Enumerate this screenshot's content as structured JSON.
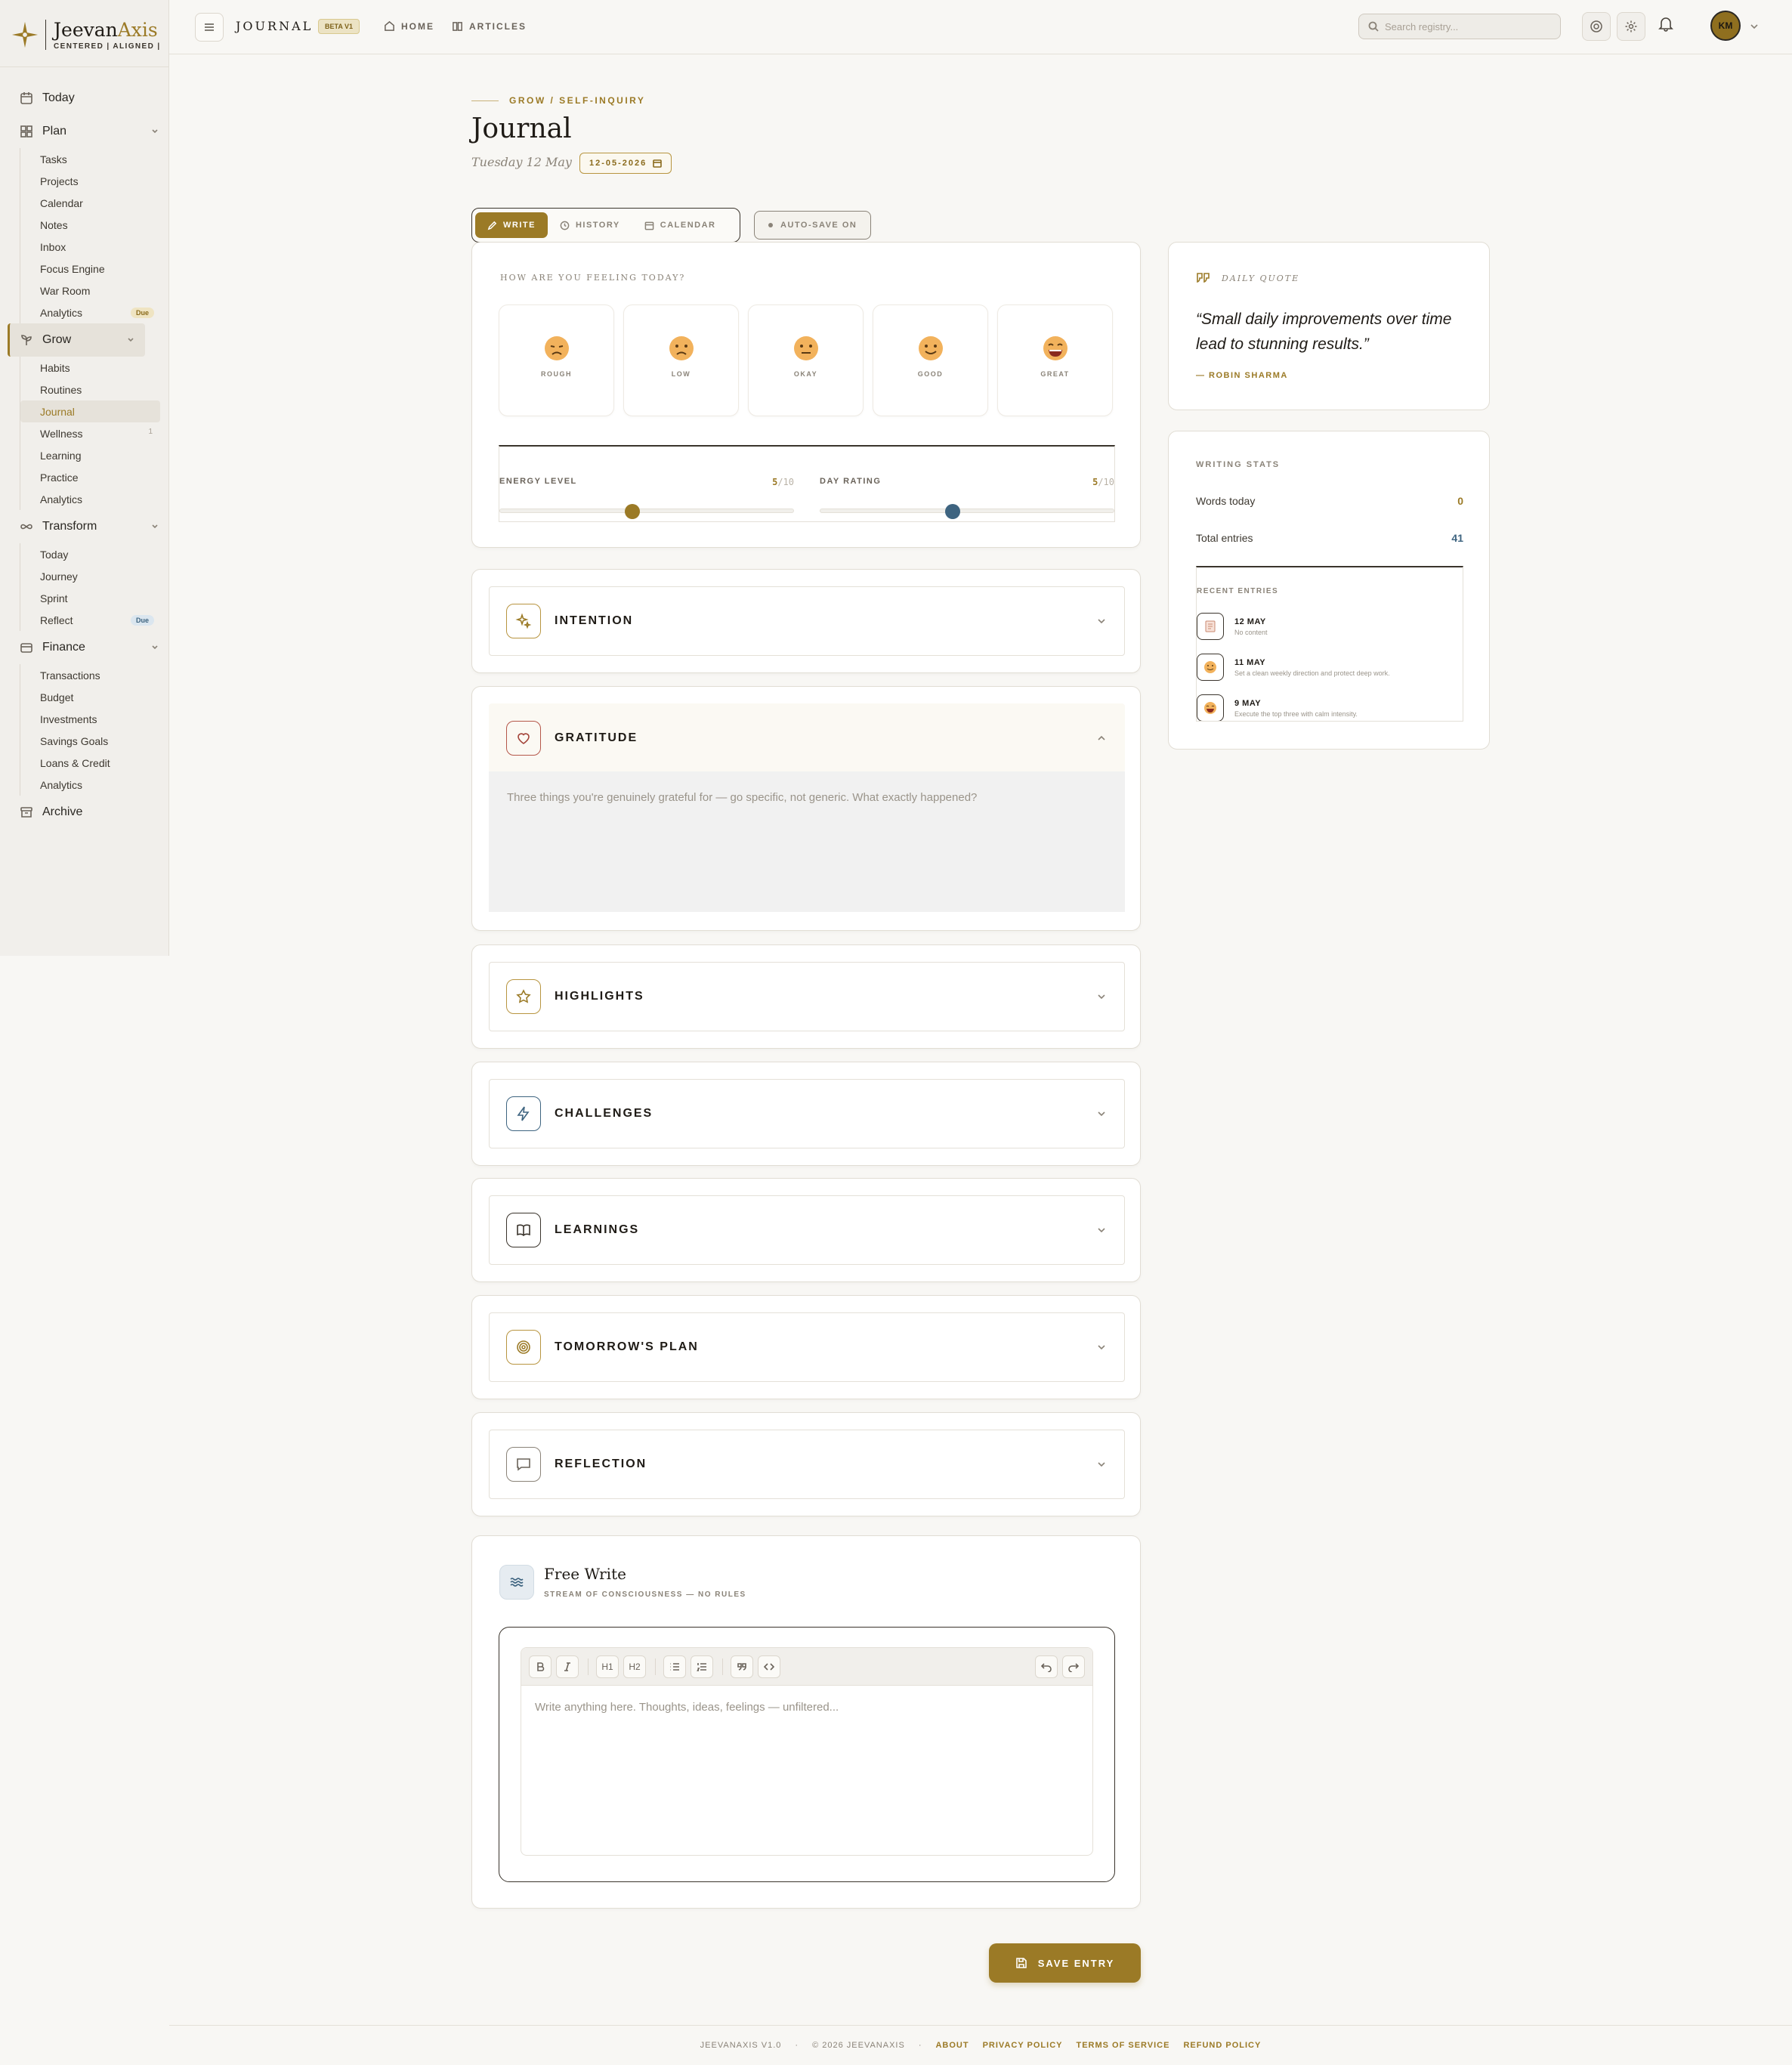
{
  "brand": {
    "name_a": "Jeevan",
    "name_b": "Axis",
    "tagline": "CENTERED | ALIGNED |"
  },
  "sidebar": {
    "today": "Today",
    "plan": {
      "label": "Plan",
      "items": [
        "Tasks",
        "Projects",
        "Calendar",
        "Notes",
        "Inbox",
        "Focus Engine",
        "War Room",
        "Analytics"
      ],
      "badge": "Due"
    },
    "grow": {
      "label": "Grow",
      "items": [
        "Habits",
        "Routines",
        "Journal",
        "Wellness",
        "Learning",
        "Practice",
        "Analytics"
      ],
      "wellness_count": "1"
    },
    "transform": {
      "label": "Transform",
      "items": [
        "Today",
        "Journey",
        "Sprint",
        "Reflect"
      ],
      "badge": "Due"
    },
    "finance": {
      "label": "Finance",
      "items": [
        "Transactions",
        "Budget",
        "Investments",
        "Savings Goals",
        "Loans & Credit",
        "Analytics"
      ]
    },
    "archive": "Archive"
  },
  "header": {
    "title": "JOURNAL",
    "beta": "BETA V1",
    "home": "HOME",
    "articles": "ARTICLES",
    "search_placeholder": "Search registry...",
    "avatar": "KM"
  },
  "page": {
    "breadcrumb": "GROW / SELF-INQUIRY",
    "title": "Journal",
    "date_text": "Tuesday 12 May",
    "date_pill": "12-05-2026"
  },
  "tabs": {
    "write": "WRITE",
    "history": "HISTORY",
    "calendar": "CALENDAR",
    "autosave": "AUTO-SAVE ON"
  },
  "mood": {
    "question": "HOW ARE YOU FEELING TODAY?",
    "options": [
      "ROUGH",
      "LOW",
      "OKAY",
      "GOOD",
      "GREAT"
    ],
    "energy": {
      "label": "ENERGY LEVEL",
      "value": "5",
      "max": "/10",
      "fraction": 0.45
    },
    "day": {
      "label": "DAY RATING",
      "value": "5",
      "max": "/10",
      "fraction": 0.45
    }
  },
  "sections": {
    "intention": "INTENTION",
    "gratitude": "GRATITUDE",
    "gratitude_placeholder": "Three things you're genuinely grateful for — go specific, not generic. What exactly happened?",
    "highlights": "HIGHLIGHTS",
    "challenges": "CHALLENGES",
    "learnings": "LEARNINGS",
    "tomorrow": "TOMORROW'S PLAN",
    "reflection": "REFLECTION"
  },
  "quote": {
    "label": "DAILY QUOTE",
    "text": "“Small daily improvements over time lead to stunning results.”",
    "author": "— ROBIN SHARMA"
  },
  "stats": {
    "label": "WRITING STATS",
    "words_label": "Words today",
    "words": "0",
    "entries_label": "Total entries",
    "entries": "41",
    "recent_label": "RECENT ENTRIES",
    "recent": [
      {
        "date": "12 MAY",
        "text": "No content"
      },
      {
        "date": "11 MAY",
        "text": "Set a clean weekly direction and protect deep work."
      },
      {
        "date": "9 MAY",
        "text": "Execute the top three with calm intensity."
      }
    ]
  },
  "freewrite": {
    "title": "Free Write",
    "subtitle": "STREAM OF CONSCIOUSNESS — NO RULES",
    "placeholder": "Write anything here. Thoughts, ideas, feelings — unfiltered...",
    "h1": "H1",
    "h2": "H2"
  },
  "save": "SAVE ENTRY",
  "footer": {
    "version": "JEEVANAXIS V1.0",
    "copyright": "© 2026 JEEVANAXIS",
    "about": "ABOUT",
    "privacy": "PRIVACY POLICY",
    "terms": "TERMS OF SERVICE",
    "refund": "REFUND POLICY"
  },
  "colors": {
    "accent": "#9b7a26",
    "blue": "#3e6480"
  }
}
